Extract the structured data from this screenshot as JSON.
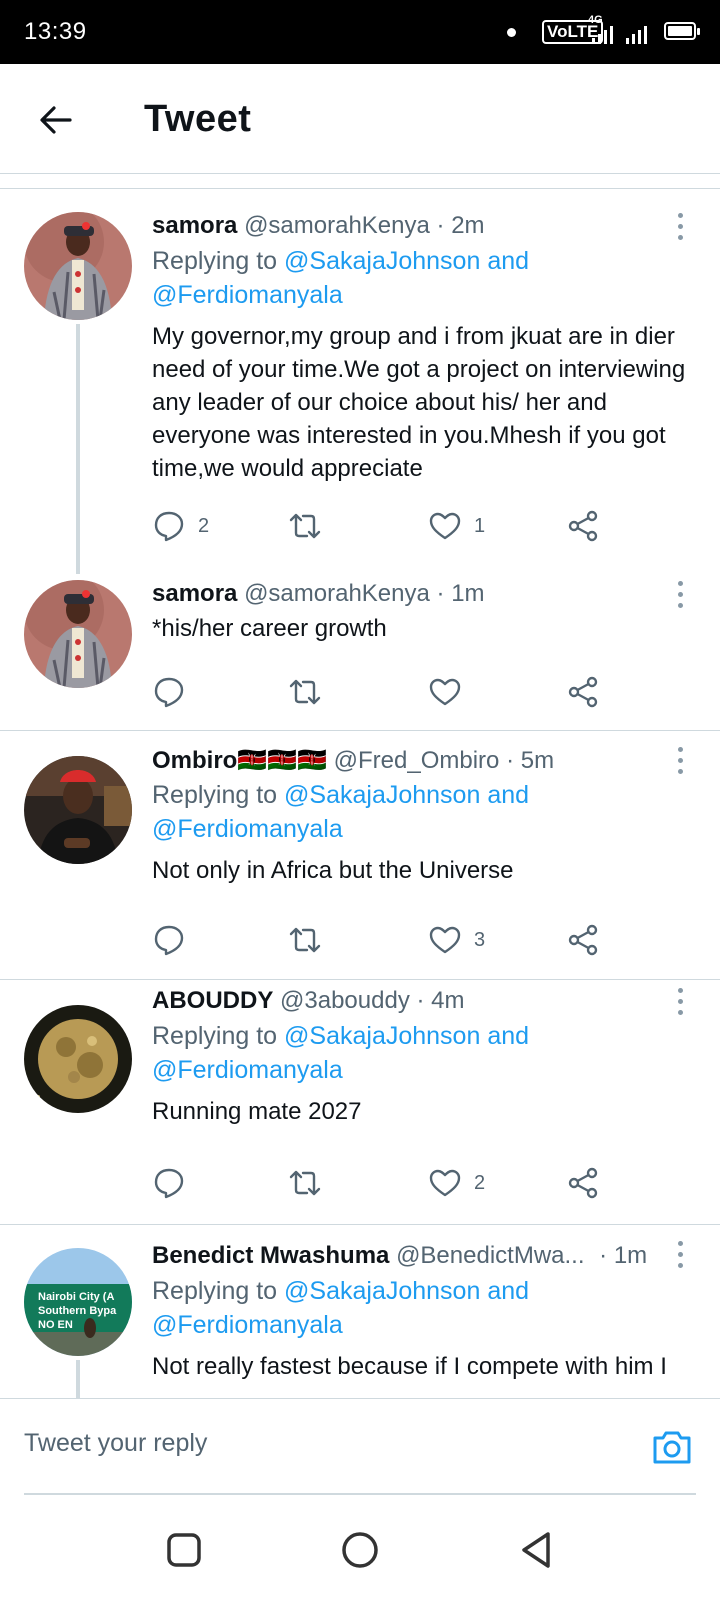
{
  "status_bar": {
    "time": "13:39",
    "volte": "VoLTE",
    "network": "4G"
  },
  "header": {
    "title": "Tweet",
    "back_icon": "arrow-left-icon"
  },
  "tweets": [
    {
      "name": "samora",
      "handle": "@samorahKenya",
      "time": "· 2m",
      "replying_prefix": "Replying to ",
      "mention1": "@SakajaJohnson and",
      "mention2": "@Ferdiomanyala",
      "text": "My governor,my group and i from jkuat are in dier need of your time.We got a project on interviewing any leader of our choice about his/ her and everyone was interested in you.Mhesh if you got time,we would appreciate",
      "replies": "2",
      "retweets": "",
      "likes": "1"
    },
    {
      "name": "samora",
      "handle": "@samorahKenya",
      "time": "· 1m",
      "text": "*his/her career growth",
      "replies": "",
      "retweets": "",
      "likes": ""
    },
    {
      "name": "Ombiro🇰🇪🇰🇪🇰🇪",
      "handle": "@Fred_Ombiro",
      "time": "· 5m",
      "replying_prefix": "Replying to ",
      "mention1": "@SakajaJohnson and",
      "mention2": "@Ferdiomanyala",
      "text": "Not only in Africa but the Universe",
      "replies": "",
      "retweets": "",
      "likes": "3"
    },
    {
      "name": "ABOUDDY",
      "handle": "@3abouddy",
      "time": "· 4m",
      "replying_prefix": "Replying to ",
      "mention1": "@SakajaJohnson and",
      "mention2": "@Ferdiomanyala",
      "text": "Running mate 2027",
      "replies": "",
      "retweets": "",
      "likes": "2"
    },
    {
      "name": "Benedict Mwashuma",
      "handle": "@BenedictMwa...",
      "time": "· 1m",
      "replying_prefix": "Replying to ",
      "mention1": "@SakajaJohnson and",
      "mention2": "@Ferdiomanyala",
      "text": "Not really fastest because if I compete with him I",
      "avatar_sign_line1": "Nairobi City (A",
      "avatar_sign_line2": "Southern Bypa",
      "avatar_sign_line3": "NO EN"
    }
  ],
  "composer": {
    "placeholder": "Tweet your reply",
    "camera_icon": "camera-icon"
  },
  "colors": {
    "accent": "#1d9bf0",
    "secondary_text": "#536471",
    "divider": "#cfd9de"
  }
}
